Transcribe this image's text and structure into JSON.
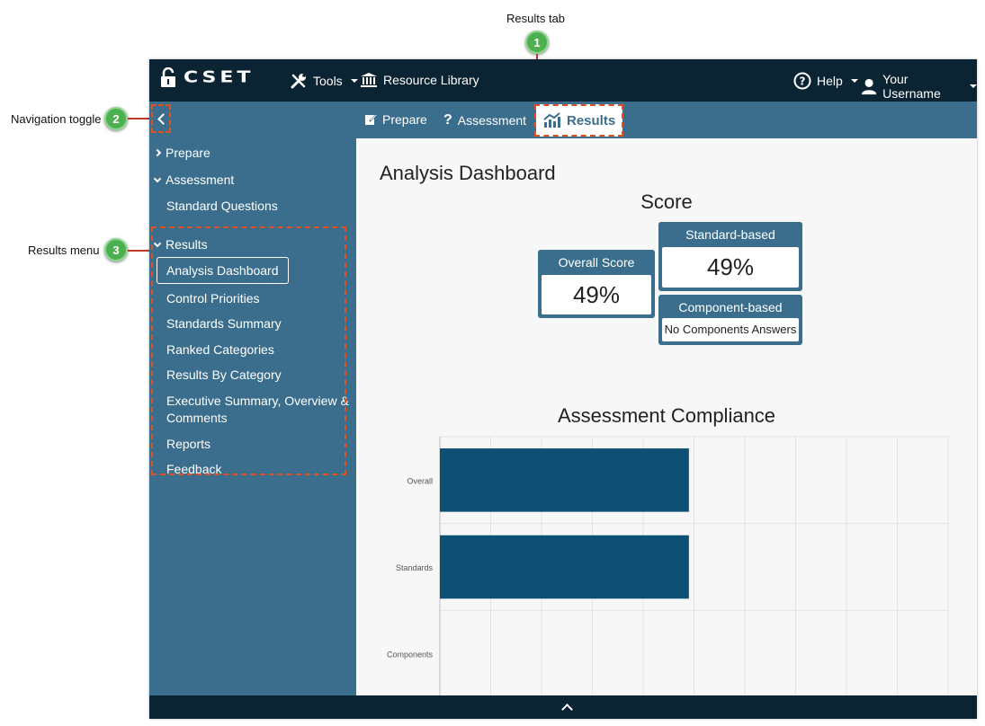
{
  "callouts": {
    "results_tab": {
      "num": "1",
      "label": "Results tab"
    },
    "nav_toggle": {
      "num": "2",
      "label": "Navigation toggle"
    },
    "results_menu": {
      "num": "3",
      "label": "Results menu"
    }
  },
  "topbar": {
    "logo": "CSET",
    "tools": "Tools",
    "resource_library": "Resource Library",
    "help": "Help",
    "user": "Your Username"
  },
  "tabs": [
    {
      "label": "Prepare",
      "icon": "edit-icon"
    },
    {
      "label": "Assessment",
      "icon": "question-icon"
    },
    {
      "label": "Results",
      "icon": "chart-icon",
      "active": true
    }
  ],
  "sidebar": {
    "prepare": "Prepare",
    "assessment": "Assessment",
    "standard_questions": "Standard Questions",
    "results": "Results",
    "items": [
      "Analysis Dashboard",
      "Control Priorities",
      "Standards Summary",
      "Ranked Categories",
      "Results By Category",
      "Executive Summary, Overview &",
      "Comments",
      "Reports",
      "Feedback"
    ]
  },
  "main": {
    "title": "Analysis Dashboard",
    "score_title": "Score",
    "overall": {
      "label": "Overall Score",
      "value": "49%"
    },
    "standard": {
      "label": "Standard-based",
      "value": "49%"
    },
    "component": {
      "label": "Component-based",
      "value": "No Components Answers"
    },
    "compliance_title": "Assessment Compliance"
  },
  "colors": {
    "topbar": "#0b2433",
    "accent": "#3a6e8c",
    "bar": "#0e5073",
    "callout": "#4caf50",
    "highlight": "#e05020"
  },
  "chart_data": {
    "type": "bar",
    "orientation": "horizontal",
    "categories": [
      "Overall",
      "Standards",
      "Components"
    ],
    "values": [
      49,
      49,
      0
    ],
    "xlim": [
      0,
      100
    ],
    "grid": true
  }
}
